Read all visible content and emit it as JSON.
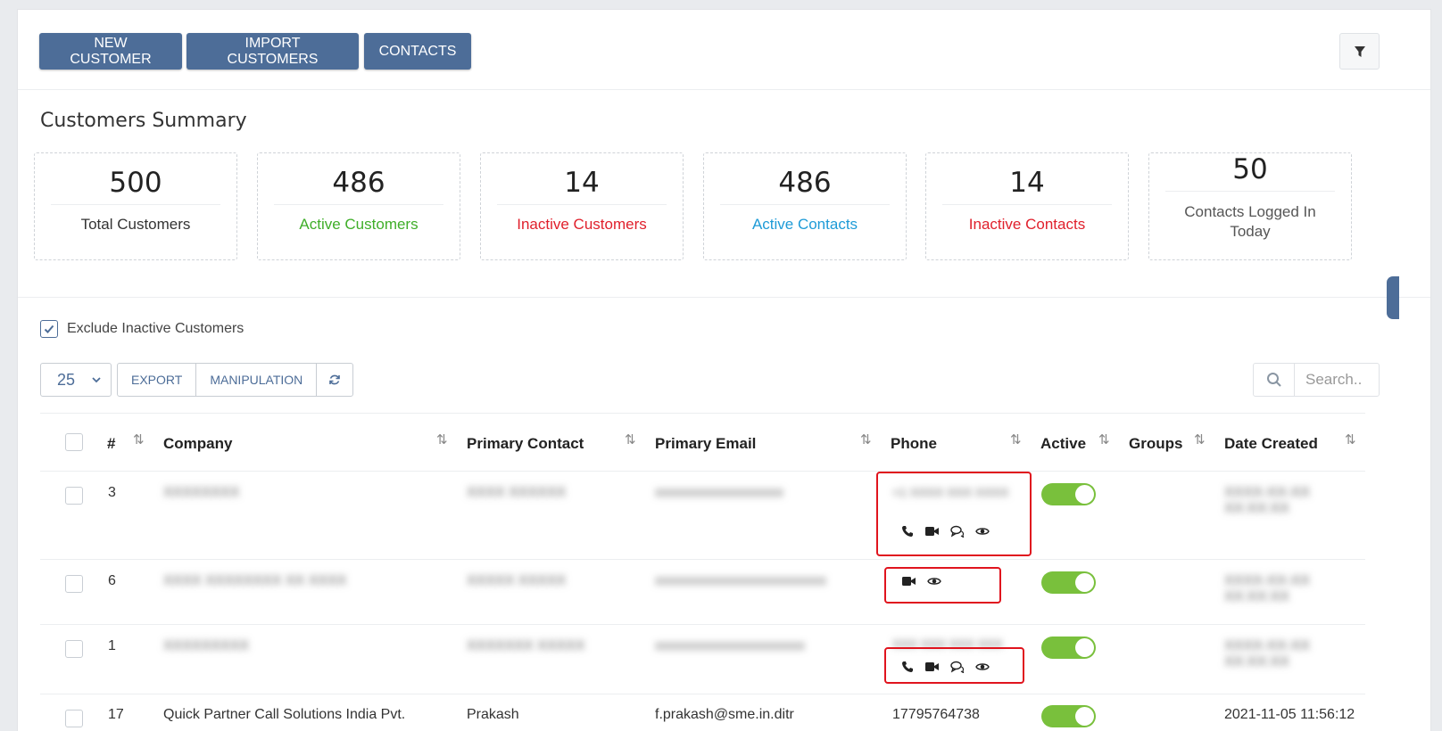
{
  "toolbar": {
    "new_customer": "NEW CUSTOMER",
    "import_customers": "IMPORT CUSTOMERS",
    "contacts": "CONTACTS"
  },
  "summary": {
    "title": "Customers Summary",
    "cards": [
      {
        "value": "500",
        "label": "Total Customers",
        "color": "#333333"
      },
      {
        "value": "486",
        "label": "Active Customers",
        "color": "#3fae29"
      },
      {
        "value": "14",
        "label": "Inactive Customers",
        "color": "#e0202c"
      },
      {
        "value": "486",
        "label": "Active Contacts",
        "color": "#1e9bd7"
      },
      {
        "value": "14",
        "label": "Inactive Contacts",
        "color": "#e0202c"
      },
      {
        "value": "50",
        "label": "Contacts Logged In Today",
        "color": "#555555"
      }
    ]
  },
  "filters": {
    "exclude_inactive_label": "Exclude Inactive Customers",
    "exclude_inactive_checked": true,
    "page_size": "25",
    "export_label": "EXPORT",
    "manipulation_label": "MANIPULATION",
    "search_placeholder": "Search.."
  },
  "table": {
    "headers": [
      "#",
      "Company",
      "Primary Contact",
      "Primary Email",
      "Phone",
      "Active",
      "Groups",
      "Date Created"
    ],
    "rows": [
      {
        "num": "3",
        "company": "XXXXXXXX",
        "contact": "XXXX XXXXXX",
        "email": "xxxxxxxxxxxxxxxxxx",
        "phone": "+1 XXXX XXX XXXX",
        "icons": [
          "phone-icon",
          "video-icon",
          "chat-icon",
          "eye-icon"
        ],
        "active": true,
        "date": "XXXX-XX-XX XX:XX:XX"
      },
      {
        "num": "6",
        "company": "XXXX XXXXXXXX XX XXXX",
        "contact": "XXXXX XXXXX",
        "email": "xxxxxxxxxxxxxxxxxxxxxxxx",
        "phone": "",
        "icons": [
          "video-icon",
          "eye-icon"
        ],
        "active": true,
        "date": "XXXX-XX-XX XX:XX:XX"
      },
      {
        "num": "1",
        "company": "XXXXXXXXX",
        "contact": "XXXXXXX XXXXX",
        "email": "xxxxxxxxxxxxxxxxxxxxx",
        "phone": "XXX XXX XXX XXX",
        "icons": [
          "phone-icon",
          "video-icon",
          "chat-icon",
          "eye-icon"
        ],
        "active": true,
        "date": "XXXX-XX-XX XX:XX:XX"
      },
      {
        "num": "17",
        "company": "Quick Partner Call Solutions India Pvt.",
        "contact": "Prakash",
        "email": "f.prakash@sme.in.ditr",
        "phone": "17795764738",
        "active": true,
        "date": "2021-11-05 11:56:12"
      }
    ]
  },
  "colors": {
    "accent": "#4d6d98",
    "active_toggle": "#79c03c",
    "highlight": "#e0141e"
  }
}
